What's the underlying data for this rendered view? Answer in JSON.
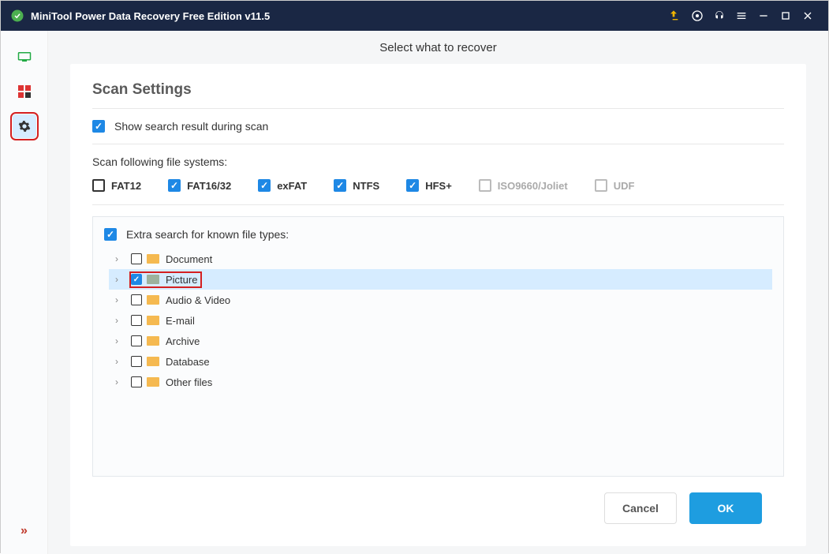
{
  "window": {
    "title": "MiniTool Power Data Recovery Free Edition v11.5"
  },
  "header": {
    "subtitle": "Select what to recover"
  },
  "page": {
    "heading": "Scan Settings"
  },
  "option_show_results": {
    "label": "Show search result during scan",
    "checked": true
  },
  "fs": {
    "title": "Scan following file systems:",
    "items": [
      {
        "label": "FAT12",
        "checked": false,
        "disabled": false
      },
      {
        "label": "FAT16/32",
        "checked": true,
        "disabled": false
      },
      {
        "label": "exFAT",
        "checked": true,
        "disabled": false
      },
      {
        "label": "NTFS",
        "checked": true,
        "disabled": false
      },
      {
        "label": "HFS+",
        "checked": true,
        "disabled": false
      },
      {
        "label": "ISO9660/Joliet",
        "checked": false,
        "disabled": true
      },
      {
        "label": "UDF",
        "checked": false,
        "disabled": true
      }
    ]
  },
  "extra": {
    "title": "Extra search for known file types:",
    "checked": true,
    "tree": [
      {
        "label": "Document",
        "checked": false,
        "selected": false
      },
      {
        "label": "Picture",
        "checked": true,
        "selected": true
      },
      {
        "label": "Audio & Video",
        "checked": false,
        "selected": false
      },
      {
        "label": "E-mail",
        "checked": false,
        "selected": false
      },
      {
        "label": "Archive",
        "checked": false,
        "selected": false
      },
      {
        "label": "Database",
        "checked": false,
        "selected": false
      },
      {
        "label": "Other files",
        "checked": false,
        "selected": false
      }
    ]
  },
  "buttons": {
    "cancel": "Cancel",
    "ok": "OK"
  }
}
